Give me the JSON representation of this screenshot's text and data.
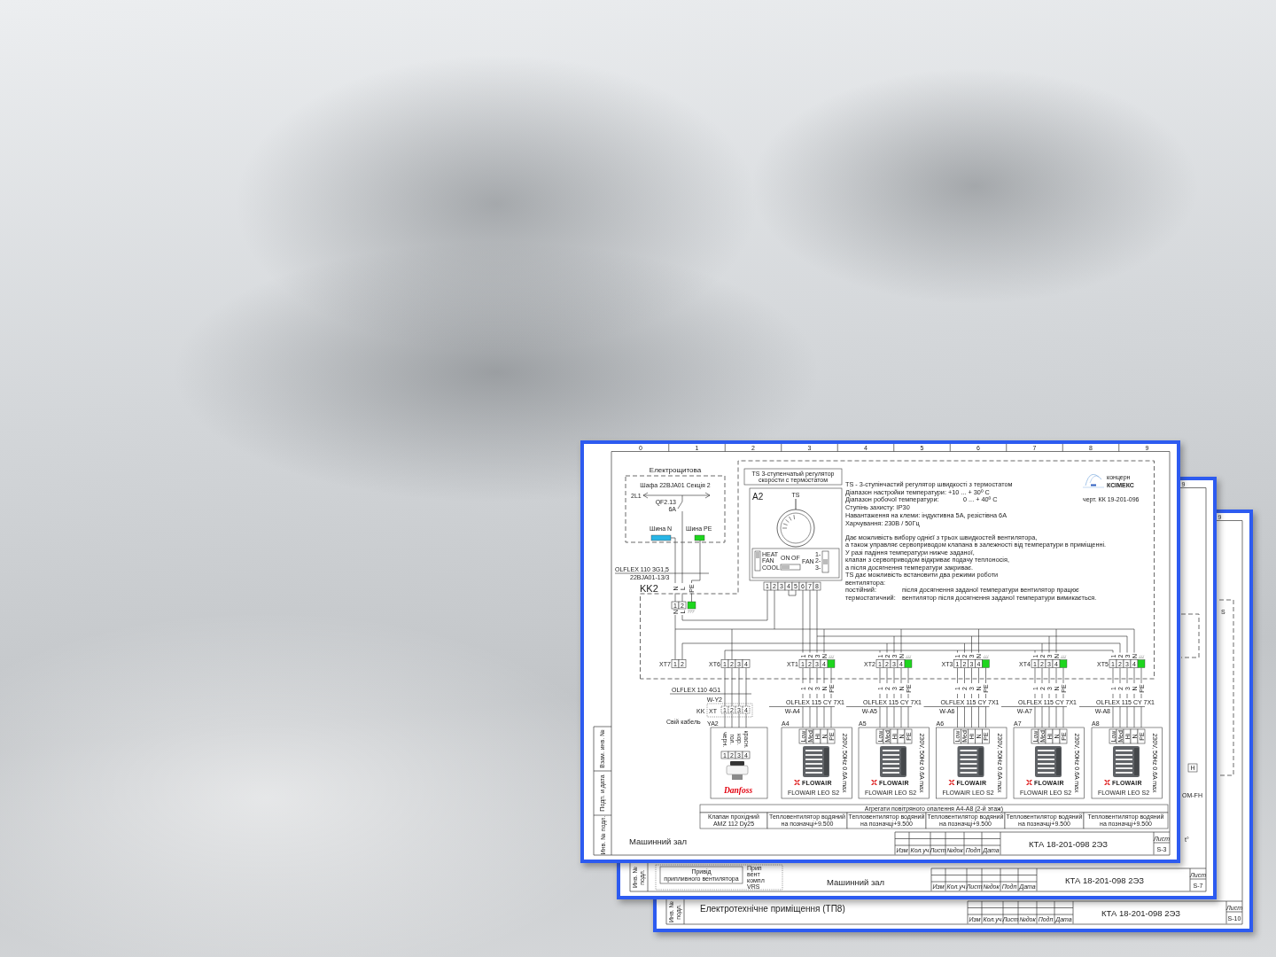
{
  "front_sheet": {
    "column_numbers": [
      "0",
      "1",
      "2",
      "3",
      "4",
      "5",
      "6",
      "7",
      "8",
      "9"
    ],
    "switchboard": {
      "title": "Електрощитова",
      "cabinet": "Шафа 22BJA01 Секція 2",
      "line": "2L1",
      "breaker": "QF2.13",
      "rating": "6A",
      "buses": [
        {
          "label": "Шина N",
          "color": "#29b6e6"
        },
        {
          "label": "Шина PE",
          "color": "#1ed61e"
        }
      ],
      "cable": "OLFLEX 110 3G1,5",
      "cable_id": "22BJA01-13/3"
    },
    "panel": {
      "label": "KK2",
      "wires_in": [
        "N",
        "L",
        "PE"
      ],
      "terminals": [
        "1",
        "2"
      ],
      "wires_out": [
        "N",
        "L"
      ]
    },
    "controller": {
      "caption": [
        "TS 3-ступенчатый регулятор",
        "скорости с термостатом"
      ],
      "label": "A2",
      "device": "TS",
      "modes": [
        "HEAT",
        "FAN",
        "COOL"
      ],
      "power": [
        "ON",
        "OF"
      ],
      "fan": "FAN",
      "speeds": [
        "1-",
        "2-",
        "3-"
      ],
      "terminals": [
        "1",
        "2",
        "3",
        "4",
        "5",
        "6",
        "7",
        "8"
      ]
    },
    "description": {
      "specs": [
        {
          "text": "TS - 3-ступінчастий регулятор швидкості з термостатом"
        },
        {
          "text": "Діапазон настройки температури: +10 ... + 30º C"
        },
        {
          "text": "Діапазон робочої температури:",
          "value": "0 ... + 40º C"
        },
        {
          "text": "Ступінь захисту: IP30"
        },
        {
          "text": "Навантаження на клеми: індуктивна 5А, резістівна 6А"
        },
        {
          "text": "Харчування: 230В / 50Гц"
        }
      ],
      "notes": [
        {
          "text": "Дає можливість вибору однієї з трьох швидкостей вентилятора,"
        },
        {
          "text": "а також управляє сервоприводом клапана в залежності від температури в приміщенні."
        },
        {
          "text": "У разі падіння температури нижче заданої,"
        },
        {
          "text": "клапан з сервоприводом відкриває подачу теплоносія,"
        },
        {
          "text": "а після досягнення температури закриває."
        },
        {
          "text": "TS дає можливість встановити два режими роботи"
        },
        {
          "text": "вентилятора:"
        },
        {
          "text": "постійний:",
          "value": "після досягнення заданої температури вентилятор працює"
        },
        {
          "text": "термостатичний:",
          "value": "вентилятор після досягнення заданої температури вимикається."
        }
      ]
    },
    "logo": {
      "caption": "концерн",
      "name": "КСІМЕКС"
    },
    "drawing_ref": "черт. КК 19-201-096",
    "terminal_strips": [
      {
        "label": "XT7",
        "terminals": [
          "1",
          "2"
        ],
        "earth": false
      },
      {
        "label": "XT6",
        "terminals": [
          "1",
          "2",
          "3",
          "4"
        ],
        "earth": false
      },
      {
        "label": "XT1",
        "terminals": [
          "1",
          "2",
          "3",
          "4"
        ],
        "earth": true,
        "wires_in": [
          "1",
          "2",
          "3",
          "N"
        ],
        "wires_out": [
          "1",
          "2",
          "3",
          "N",
          "PE"
        ]
      },
      {
        "label": "XT2",
        "terminals": [
          "1",
          "2",
          "3",
          "4"
        ],
        "earth": true,
        "wires_in": [
          "1",
          "2",
          "3",
          "N"
        ],
        "wires_out": [
          "1",
          "2",
          "3",
          "N",
          "PE"
        ]
      },
      {
        "label": "XT3",
        "terminals": [
          "1",
          "2",
          "3",
          "4"
        ],
        "earth": true,
        "wires_in": [
          "1",
          "2",
          "3",
          "N"
        ],
        "wires_out": [
          "1",
          "2",
          "3",
          "N",
          "PE"
        ]
      },
      {
        "label": "XT4",
        "terminals": [
          "1",
          "2",
          "3",
          "4"
        ],
        "earth": true,
        "wires_in": [
          "1",
          "2",
          "3",
          "N"
        ],
        "wires_out": [
          "1",
          "2",
          "3",
          "N",
          "PE"
        ]
      },
      {
        "label": "XT5",
        "terminals": [
          "1",
          "2",
          "3",
          "4"
        ],
        "earth": true,
        "wires_in": [
          "1",
          "2",
          "3",
          "N"
        ],
        "wires_out": [
          "1",
          "2",
          "3",
          "N",
          "PE"
        ]
      }
    ],
    "valve_cable": {
      "cable": "OLFLEX 110 4G1",
      "cable_id": "W-Y2"
    },
    "junction": {
      "label": "KK",
      "strip": "XT",
      "terminals": [
        "1",
        "2",
        "3",
        "4"
      ],
      "note": "Свій кабель"
    },
    "valve": {
      "label": "YA2",
      "wires": [
        "черн.",
        "гол.",
        "кор.",
        "красн."
      ],
      "terminals": [
        "1",
        "2",
        "3",
        "4"
      ],
      "brand": "Danfoss"
    },
    "heaters": [
      {
        "label": "A4",
        "cable": "OLFLEX 115 CY 7X1",
        "cable_id": "W-A4",
        "terminals": [
          "Low",
          "Med",
          "Hi",
          "N",
          "PE"
        ],
        "brand": "FLOWAIR",
        "model": "FLOWAIR LEO S2",
        "rating": "230V, 50Hz 0.6A max"
      },
      {
        "label": "A5",
        "cable": "OLFLEX 115 CY 7X1",
        "cable_id": "W-A5",
        "terminals": [
          "Low",
          "Med",
          "Hi",
          "N",
          "PE"
        ],
        "brand": "FLOWAIR",
        "model": "FLOWAIR LEO S2",
        "rating": "230V, 50Hz 0.6A max"
      },
      {
        "label": "A6",
        "cable": "OLFLEX 115 CY 7X1",
        "cable_id": "W-A6",
        "terminals": [
          "Low",
          "Med",
          "Hi",
          "N",
          "PE"
        ],
        "brand": "FLOWAIR",
        "model": "FLOWAIR LEO S2",
        "rating": "230V, 50Hz 0.6A max"
      },
      {
        "label": "A7",
        "cable": "OLFLEX 115 CY 7X1",
        "cable_id": "W-A7",
        "terminals": [
          "Low",
          "Med",
          "Hi",
          "N",
          "PE"
        ],
        "brand": "FLOWAIR",
        "model": "FLOWAIR LEO S2",
        "rating": "230V, 50Hz 0.6A max"
      },
      {
        "label": "A8",
        "cable": "OLFLEX 115 CY 7X1",
        "cable_id": "W-A8",
        "terminals": [
          "Low",
          "Med",
          "Hi",
          "N",
          "PE"
        ],
        "brand": "FLOWAIR",
        "model": "FLOWAIR LEO S2",
        "rating": "230V, 50Hz 0.6A max"
      }
    ],
    "table": {
      "heading": "Агрегати повітряного опалення A4-A8 (2-й этаж)",
      "cells": [
        [
          "Клапан прохідний",
          "AMZ 112 Dy25"
        ],
        [
          "Тепловентилятор водяний",
          "на позначці+9.500"
        ],
        [
          "Тепловентилятор водяний",
          "на позначці+9.500"
        ],
        [
          "Тепловентилятор водяний",
          "на позначці+9.500"
        ],
        [
          "Тепловентилятор водяний",
          "на позначці+9.500"
        ],
        [
          "Тепловентилятор водяний",
          "на позначці+9.500"
        ]
      ]
    },
    "side_labels": [
      "Взам. инв. №",
      "Подп. и дата",
      "Инв. № подл."
    ],
    "title": "Машинний зал",
    "title_block": {
      "headers": [
        "Изм",
        "Кол.уч",
        "Лист",
        "№док",
        "Подп",
        "Дата"
      ],
      "number": "КТА 18-201-098 2ЭЗ",
      "sheet_label": "Лист",
      "sheet": "S-3"
    }
  },
  "middle_sheet": {
    "column_numbers": [
      "9"
    ],
    "side_labels": [
      "Инв. № подл."
    ],
    "caption": [
      "Привід",
      "припливного вентилятора"
    ],
    "cut_label": [
      "Прип",
      "вент",
      "компл",
      "VRS"
    ],
    "marks": [
      "H",
      "ОМ-FH",
      "t°"
    ],
    "title": "Машинний зал",
    "title_block": {
      "headers": [
        "Изм",
        "Кол.уч",
        "Лист",
        "№док",
        "Подп",
        "Дата"
      ],
      "number": "КТА 18-201-098 2ЭЗ",
      "sheet_label": "Лист",
      "sheet": "S-7"
    }
  },
  "back_sheet": {
    "column_numbers": [
      "9"
    ],
    "side_labels": [
      "Инв. № подл."
    ],
    "marks": [
      "S"
    ],
    "title": "Електротехнічне приміщення (ТП8)",
    "title_block": {
      "headers": [
        "Изм",
        "Кол.уч",
        "Лист",
        "№док",
        "Подп",
        "Дата"
      ],
      "number": "КТА 18-201-098 2ЭЗ",
      "sheet_label": "Лист",
      "sheet": "S-10"
    }
  }
}
